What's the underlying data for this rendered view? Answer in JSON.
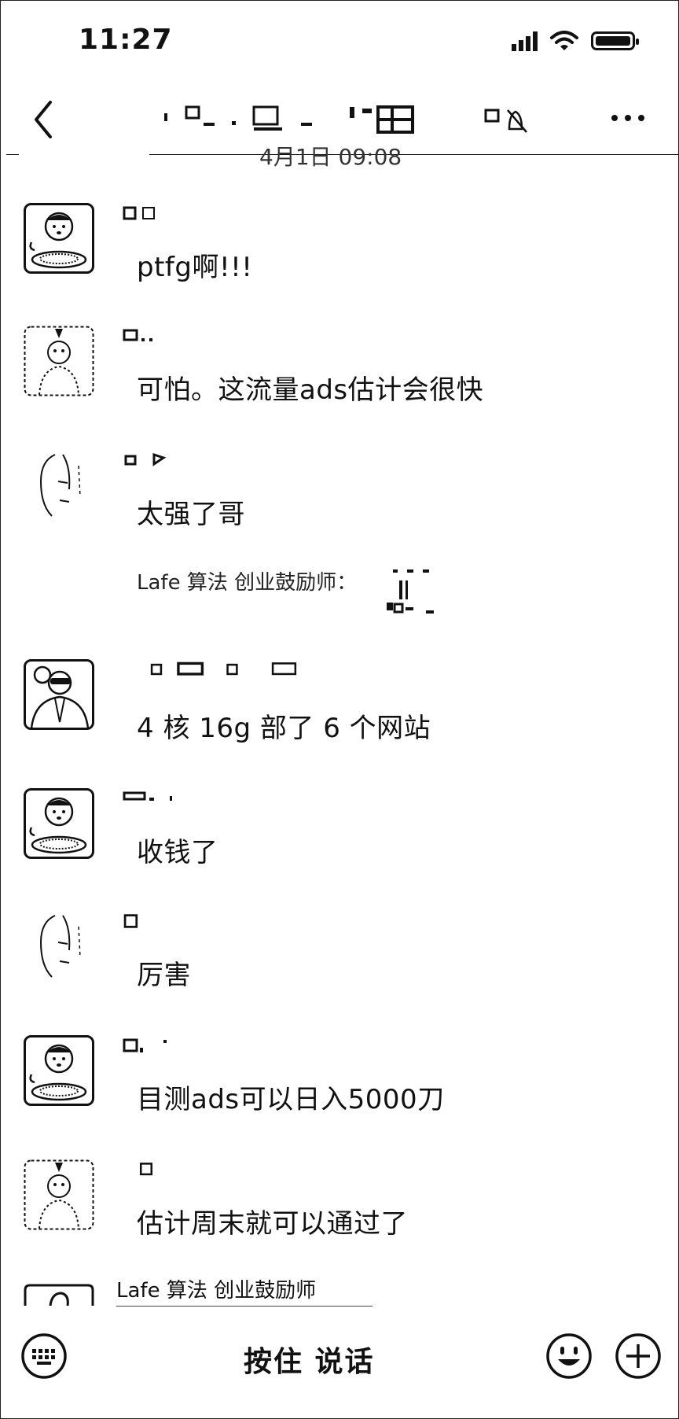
{
  "status_bar": {
    "time": "11:27"
  },
  "date_separator": "4月1日 09:08",
  "messages": [
    {
      "text": "ptfg啊!!!"
    },
    {
      "text": "可怕。这流量ads估计会很快"
    },
    {
      "text": "太强了哥",
      "quote": "Lafe 算法 创业鼓励师："
    },
    {
      "text": "4 核 16g  部了 6 个网站"
    },
    {
      "text": "收钱了"
    },
    {
      "text": "厉害"
    },
    {
      "text": "目测ads可以日入5000刀"
    },
    {
      "text": "估计周末就可以通过了"
    }
  ],
  "partial_sender": "Lafe 算法 创业鼓励师",
  "input_bar": {
    "hold_to_talk_label": "按住 说话"
  },
  "icons": {
    "back": "chevron-left-icon",
    "mute": "bell-off-icon",
    "more": "more-dots-icon",
    "keyboard": "keyboard-icon",
    "emoji": "emoji-icon",
    "plus": "plus-circle-icon"
  }
}
